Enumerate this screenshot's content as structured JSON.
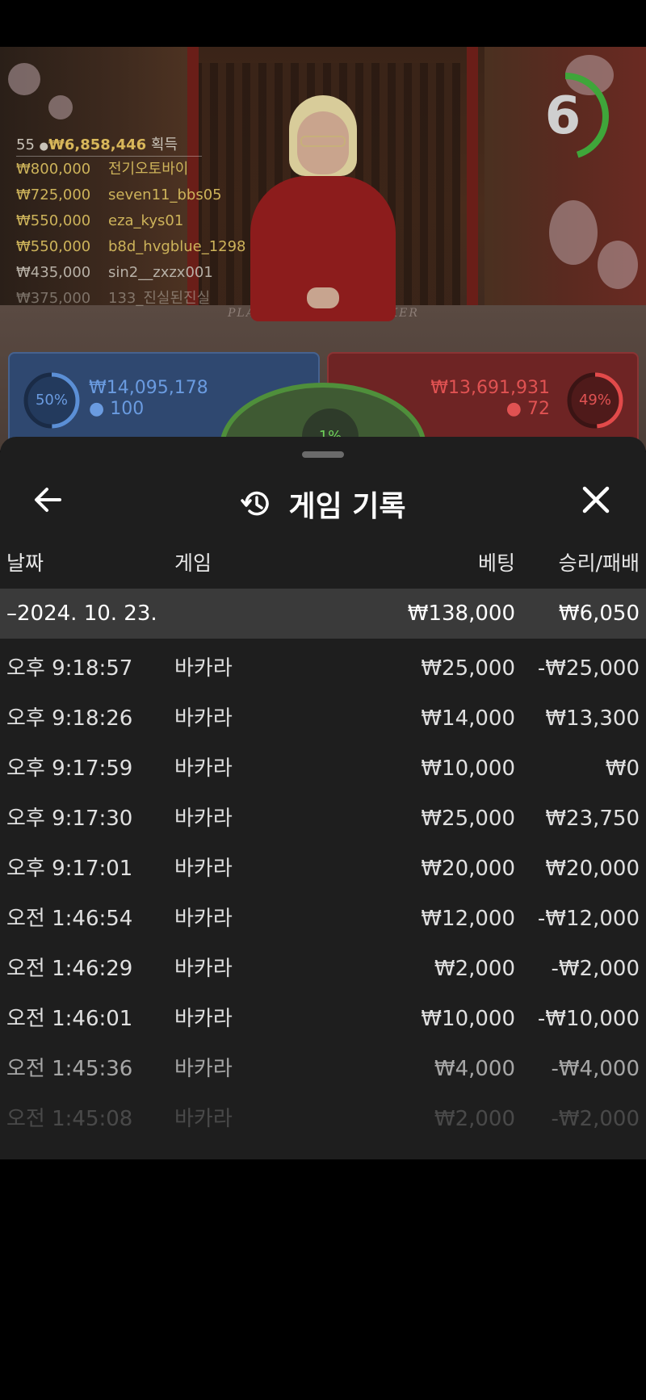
{
  "live": {
    "winners_summary": {
      "count": "55",
      "total": "₩6,858,446",
      "suffix": "획득"
    },
    "winners": [
      {
        "amount": "₩800,000",
        "name": "전기오토바이"
      },
      {
        "amount": "₩725,000",
        "name": "seven11_bbs05"
      },
      {
        "amount": "₩550,000",
        "name": "eza_kys01"
      },
      {
        "amount": "₩550,000",
        "name": "b8d_hvgblue_1298"
      },
      {
        "amount": "₩435,000",
        "name": "sin2__zxzx001"
      },
      {
        "amount": "₩375,000",
        "name": "133_진실된진실"
      }
    ],
    "table_labels": {
      "player": "PLAYER",
      "banker": "BANKER"
    },
    "timer": {
      "value": "6",
      "fraction_remaining": 0.45
    },
    "player_bets": {
      "percent": "50%",
      "amount": "₩14,095,178",
      "players": "100"
    },
    "banker_bets": {
      "percent": "49%",
      "amount": "₩13,691,931",
      "players": "72"
    },
    "tie_bets": {
      "percent": "1%"
    },
    "colors": {
      "player": "#5b8fd6",
      "banker": "#e24a4a",
      "tie": "#4fb33b",
      "gold": "#d8b75a"
    }
  },
  "history": {
    "title": "게임 기록",
    "icons": {
      "back": "arrow-left-icon",
      "history": "history-icon",
      "close": "close-icon"
    },
    "columns": {
      "date": "날짜",
      "game": "게임",
      "bet": "베팅",
      "result": "승리/패배"
    },
    "day": {
      "date": "–2024. 10. 23.",
      "bet": "₩138,000",
      "result": "₩6,050"
    },
    "rows": [
      {
        "time": "오후 9:18:57",
        "game": "바카라",
        "bet": "₩25,000",
        "result": "-₩25,000"
      },
      {
        "time": "오후 9:18:26",
        "game": "바카라",
        "bet": "₩14,000",
        "result": "₩13,300"
      },
      {
        "time": "오후 9:17:59",
        "game": "바카라",
        "bet": "₩10,000",
        "result": "₩0"
      },
      {
        "time": "오후 9:17:30",
        "game": "바카라",
        "bet": "₩25,000",
        "result": "₩23,750"
      },
      {
        "time": "오후 9:17:01",
        "game": "바카라",
        "bet": "₩20,000",
        "result": "₩20,000"
      },
      {
        "time": "오전 1:46:54",
        "game": "바카라",
        "bet": "₩12,000",
        "result": "-₩12,000"
      },
      {
        "time": "오전 1:46:29",
        "game": "바카라",
        "bet": "₩2,000",
        "result": "-₩2,000"
      },
      {
        "time": "오전 1:46:01",
        "game": "바카라",
        "bet": "₩10,000",
        "result": "-₩10,000"
      },
      {
        "time": "오전 1:45:36",
        "game": "바카라",
        "bet": "₩4,000",
        "result": "-₩4,000"
      },
      {
        "time": "오전 1:45:08",
        "game": "바카라",
        "bet": "₩2,000",
        "result": "-₩2,000"
      }
    ]
  }
}
